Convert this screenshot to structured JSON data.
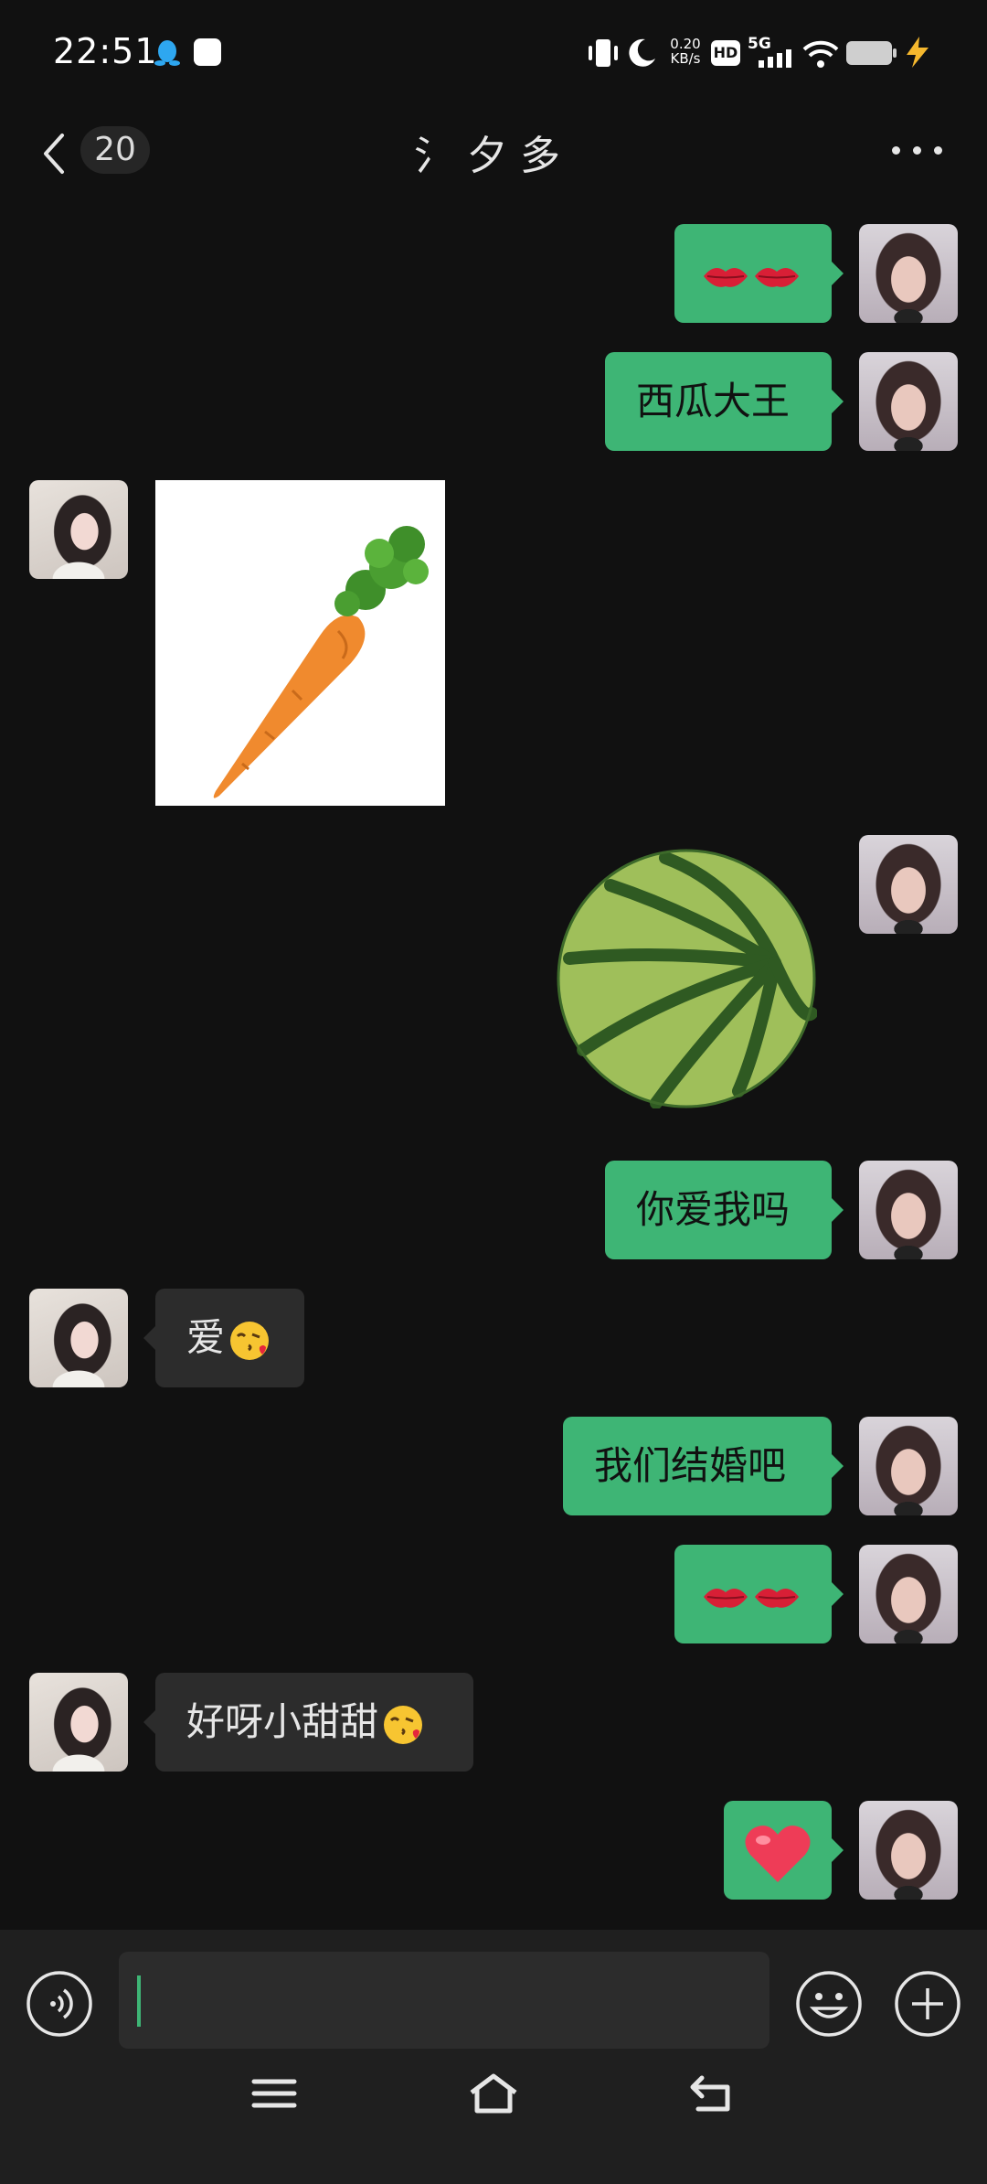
{
  "status_bar": {
    "time": "22:51",
    "net_speed_value": "0.20",
    "net_speed_unit": "KB/s",
    "hd_label": "HD",
    "signal_label": "5G",
    "icons": [
      "qq-icon",
      "app-icon",
      "vibrate-icon",
      "moon-icon",
      "signal-icon",
      "wifi-icon",
      "battery-icon",
      "charging-icon"
    ]
  },
  "header": {
    "unread_count": "20",
    "title": "氵夕多",
    "more_icon": "more-icon"
  },
  "messages": [
    {
      "sender": "me",
      "type": "emoji",
      "content": "lips-emoji x2"
    },
    {
      "sender": "me",
      "type": "text",
      "text": "西瓜大王"
    },
    {
      "sender": "other",
      "type": "sticker",
      "content": "carrot"
    },
    {
      "sender": "me",
      "type": "sticker",
      "content": "watermelon"
    },
    {
      "sender": "me",
      "type": "text",
      "text": "你爱我吗"
    },
    {
      "sender": "other",
      "type": "text",
      "text": "爱",
      "emoji": "kiss-emoji"
    },
    {
      "sender": "me",
      "type": "text",
      "text": "我们结婚吧"
    },
    {
      "sender": "me",
      "type": "emoji",
      "content": "lips-emoji x2"
    },
    {
      "sender": "other",
      "type": "text",
      "text": "好呀小甜甜",
      "emoji": "kiss-emoji"
    },
    {
      "sender": "me",
      "type": "emoji",
      "content": "heart-emoji"
    }
  ],
  "input_bar": {
    "value": "",
    "icons": [
      "voice-icon",
      "emoji-icon",
      "plus-icon"
    ]
  },
  "system_nav": {
    "icons": [
      "menu-icon",
      "home-icon",
      "back-icon"
    ]
  },
  "colors": {
    "background": "#111111",
    "my_bubble": "#3eb575",
    "other_bubble": "#2c2c2c",
    "input_bar": "#1f1f1f"
  }
}
